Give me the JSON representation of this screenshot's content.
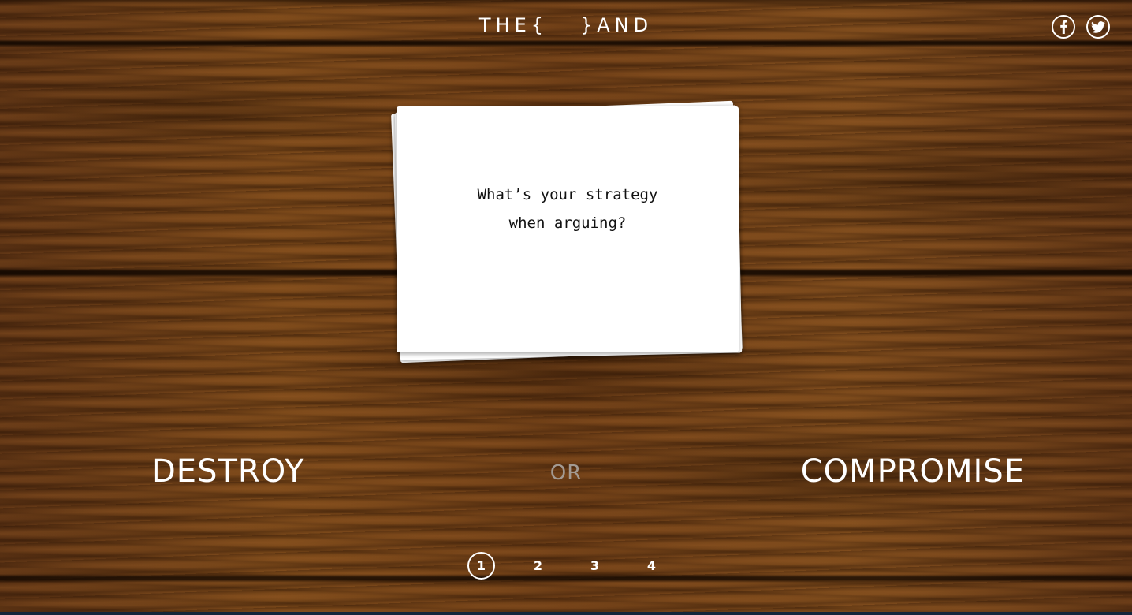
{
  "header": {
    "logo_text": "THE{   }AND"
  },
  "social": {
    "items": [
      {
        "icon": "facebook-icon",
        "label": "f"
      },
      {
        "icon": "twitter-icon",
        "label": "twitter"
      }
    ]
  },
  "card": {
    "question_line1": "What’s your strategy",
    "question_line2": "when arguing?"
  },
  "choices": {
    "left": "DESTROY",
    "or": "OR",
    "right": "COMPROMISE"
  },
  "pagination": {
    "pages": [
      "1",
      "2",
      "3",
      "4"
    ],
    "current": 1
  },
  "colors": {
    "text": "#ffffff",
    "or_text": "#a39a92",
    "card": "#ffffff",
    "wood_base": "#6e3f17"
  }
}
